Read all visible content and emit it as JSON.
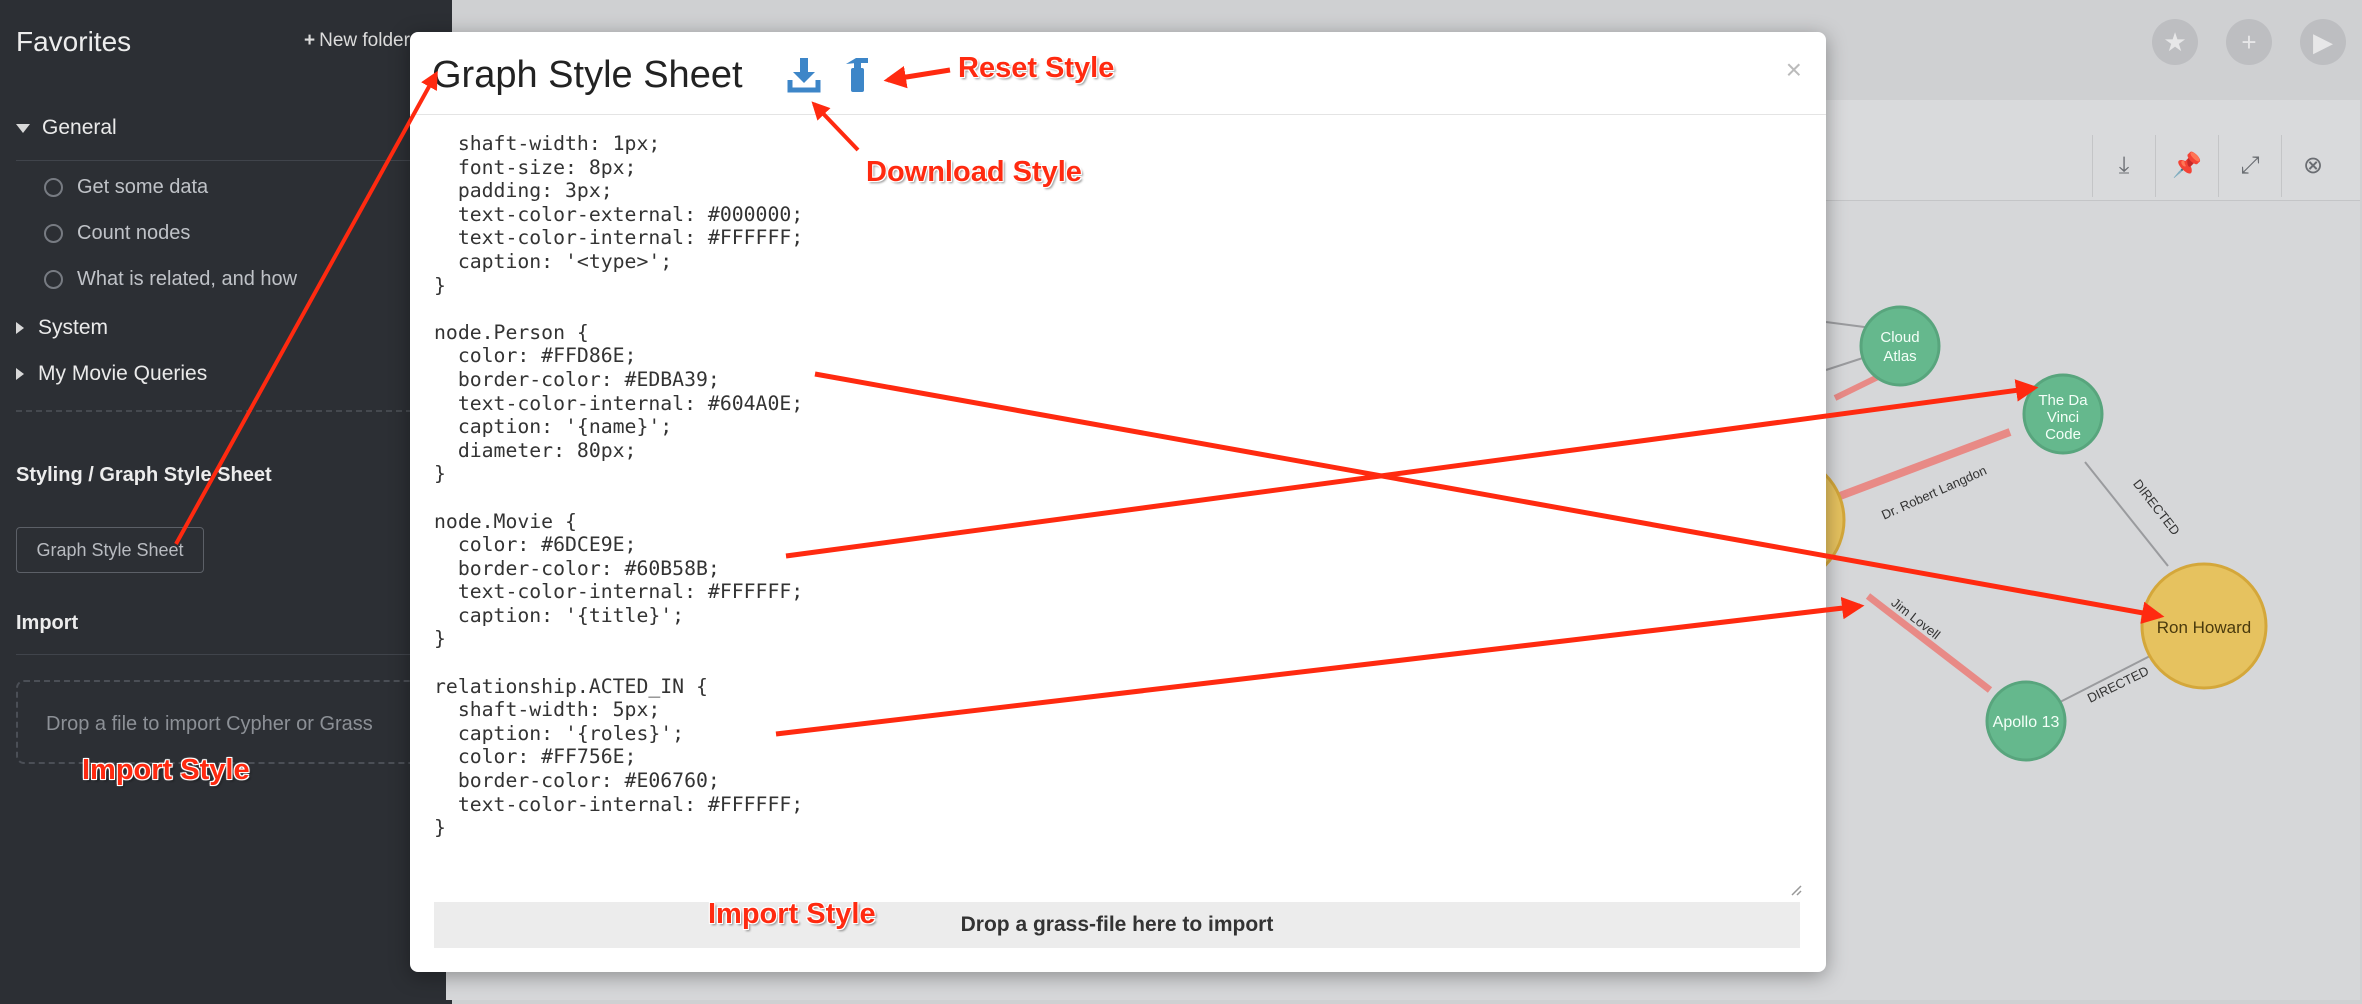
{
  "sidebar": {
    "title": "Favorites",
    "new_folder": "New folder",
    "general_label": "General",
    "general_items": [
      "Get some data",
      "Count nodes",
      "What is related, and how"
    ],
    "system_label": "System",
    "my_queries_label": "My Movie Queries",
    "styling_heading": "Styling / Graph Style Sheet",
    "styling_button": "Graph Style Sheet",
    "import_heading": "Import",
    "import_drop": "Drop a file to import Cypher or Grass"
  },
  "modal": {
    "title": "Graph Style Sheet",
    "close": "×",
    "stylesheet_text": "  shaft-width: 1px;\n  font-size: 8px;\n  padding: 3px;\n  text-color-external: #000000;\n  text-color-internal: #FFFFFF;\n  caption: '<type>';\n}\n\nnode.Person {\n  color: #FFD86E;\n  border-color: #EDBA39;\n  text-color-internal: #604A0E;\n  caption: '{name}';\n  diameter: 80px;\n}\n\nnode.Movie {\n  color: #6DCE9E;\n  border-color: #60B58B;\n  text-color-internal: #FFFFFF;\n  caption: '{title}';\n}\n\nrelationship.ACTED_IN {\n  shaft-width: 5px;\n  caption: '{roles}';\n  color: #FF756E;\n  border-color: #E06760;\n  text-color-internal: #FFFFFF;\n}",
    "drop_label": "Drop a grass-file here to import"
  },
  "graph": {
    "nodes": {
      "cloud_atlas": "Cloud\nAtlas",
      "da_vinci_l1": "The Da",
      "da_vinci_l2": "Vinci",
      "da_vinci_l3": "Code",
      "ron_howard": "Ron Howard",
      "apollo": "Apollo 13"
    },
    "rel_labels": {
      "robert_langdon": "Dr. Robert Langdon",
      "jim_lovell": "Jim Lovell",
      "directed_1": "DIRECTED",
      "directed_2": "DIRECTED"
    }
  },
  "annotations": {
    "reset_style": "Reset Style",
    "download_style": "Download Style",
    "import_style_sidebar": "Import Style",
    "import_style_modal": "Import Style"
  },
  "colors": {
    "arrow": "#ff2a10",
    "movie_fill": "#6DCE9E",
    "movie_border": "#60B58B",
    "person_fill": "#FFD86E",
    "person_border": "#EDBA39",
    "acted_in": "#FF756E",
    "icon_blue": "#3d86c8"
  }
}
